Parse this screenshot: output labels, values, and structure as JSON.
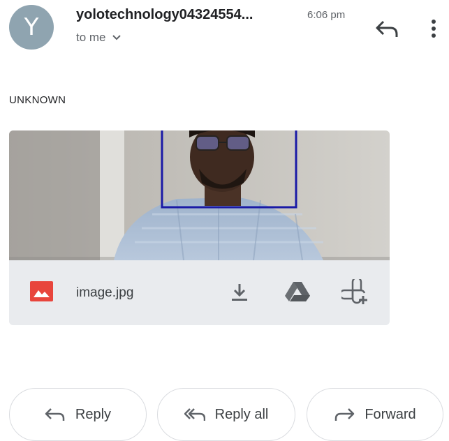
{
  "header": {
    "avatar_letter": "Y",
    "sender": "yolotechnology04324554...",
    "time": "6:06 pm",
    "recipient": "to me"
  },
  "message": {
    "body": "UNKNOWN"
  },
  "attachment": {
    "filename": "image.jpg"
  },
  "actions": {
    "reply": "Reply",
    "reply_all": "Reply all",
    "forward": "Forward"
  },
  "colors": {
    "attachment_icon": "#e8453c",
    "detection_box": "#1a1aa6",
    "icon_gray": "#5f6368"
  }
}
